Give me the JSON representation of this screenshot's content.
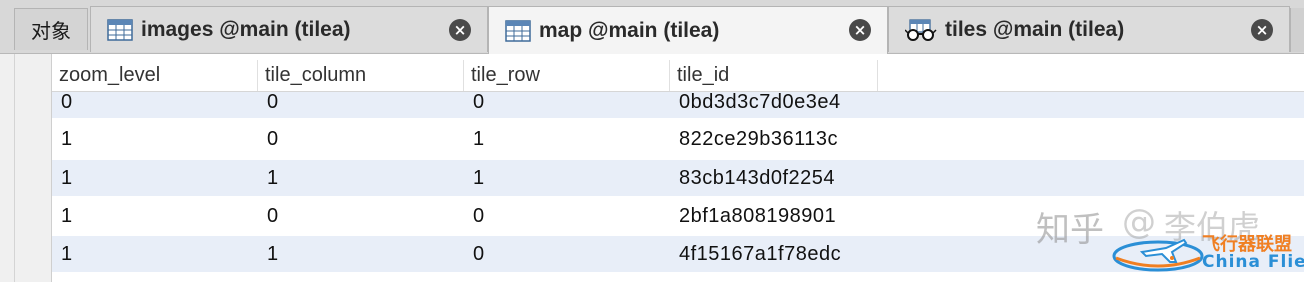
{
  "tabbar": {
    "objects_label": "对象",
    "tabs": [
      {
        "label": "images @main (tilea)",
        "icon": "table-icon",
        "active": false
      },
      {
        "label": "map @main (tilea)",
        "icon": "table-icon",
        "active": true
      },
      {
        "label": "tiles @main (tilea)",
        "icon": "view-glasses-icon",
        "active": false
      }
    ],
    "close_glyph": "×"
  },
  "table": {
    "columns": [
      "zoom_level",
      "tile_column",
      "tile_row",
      "tile_id"
    ],
    "rows": [
      [
        "0",
        "0",
        "0",
        "0bd3d3c7d0e3e4"
      ],
      [
        "1",
        "0",
        "1",
        "822ce29b36113c"
      ],
      [
        "1",
        "1",
        "1",
        "83cb143d0f2254"
      ],
      [
        "1",
        "0",
        "0",
        "2bf1a808198901"
      ],
      [
        "1",
        "1",
        "0",
        "4f15167a1f78edc"
      ]
    ]
  },
  "watermark": {
    "zh": "知乎",
    "at": "@",
    "author": "李伯虎",
    "brand_cn": "飞行器联盟",
    "brand_en": "China Flier"
  },
  "colors": {
    "tabbar_bg": "#d8d8d8",
    "active_tab_bg": "#f4f4f4",
    "row_alt": "#e8eef8",
    "brand_orange": "#f07f22",
    "brand_blue": "#2b8fd6"
  }
}
